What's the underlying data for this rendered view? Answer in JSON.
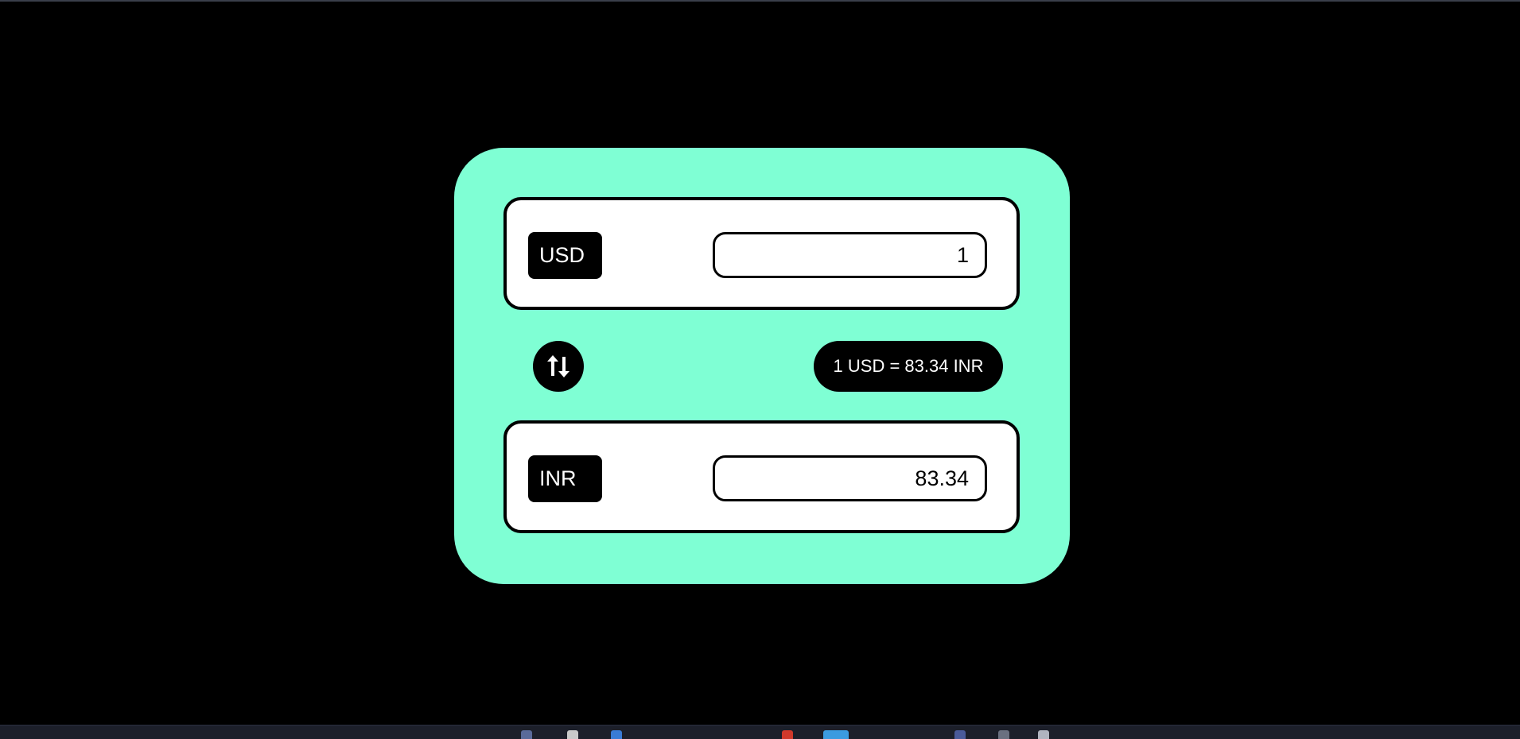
{
  "converter": {
    "from": {
      "currency": "USD",
      "amount": "1"
    },
    "to": {
      "currency": "INR",
      "amount": "83.34"
    },
    "rate_text": "1 USD = 83.34 INR",
    "swap_icon": "swap-vertical-icon"
  },
  "colors": {
    "background": "#000000",
    "card": "#7fffd4",
    "panel": "#ffffff",
    "accent": "#000000"
  },
  "taskbar": {
    "icons": [
      "search-icon",
      "app-icon",
      "app-icon",
      "browser-icon",
      "app-icon",
      "app-icon",
      "app-icon",
      "app-icon",
      "app-icon"
    ]
  }
}
